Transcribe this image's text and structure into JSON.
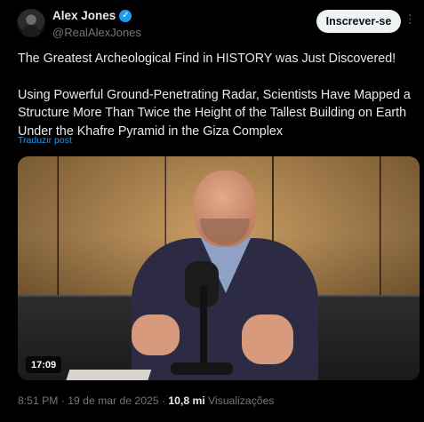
{
  "author": {
    "display_name": "Alex Jones",
    "handle": "@RealAlexJones",
    "verified_icon": "check"
  },
  "subscribe_label": "Inscrever-se",
  "more_icon": "…",
  "tweet": {
    "headline": "The Greatest Archeological Find in HISTORY was Just Discovered!",
    "body": "Using Powerful Ground-Penetrating Radar, Scientists Have Mapped a Structure More Than Twice the Height of the Tallest Building on Earth Under the Khafre Pyramid in the Giza Complex",
    "translate_label": "Traduzir post"
  },
  "video": {
    "duration": "17:09"
  },
  "meta": {
    "time": "8:51 PM",
    "separator": " · ",
    "date": "19 de mar de 2025",
    "views_count": "10,8 mi",
    "views_label": "Visualizações"
  },
  "colors": {
    "background": "#000000",
    "accent": "#1d9bf0",
    "text": "#e7e9ea",
    "muted": "#71767b"
  }
}
